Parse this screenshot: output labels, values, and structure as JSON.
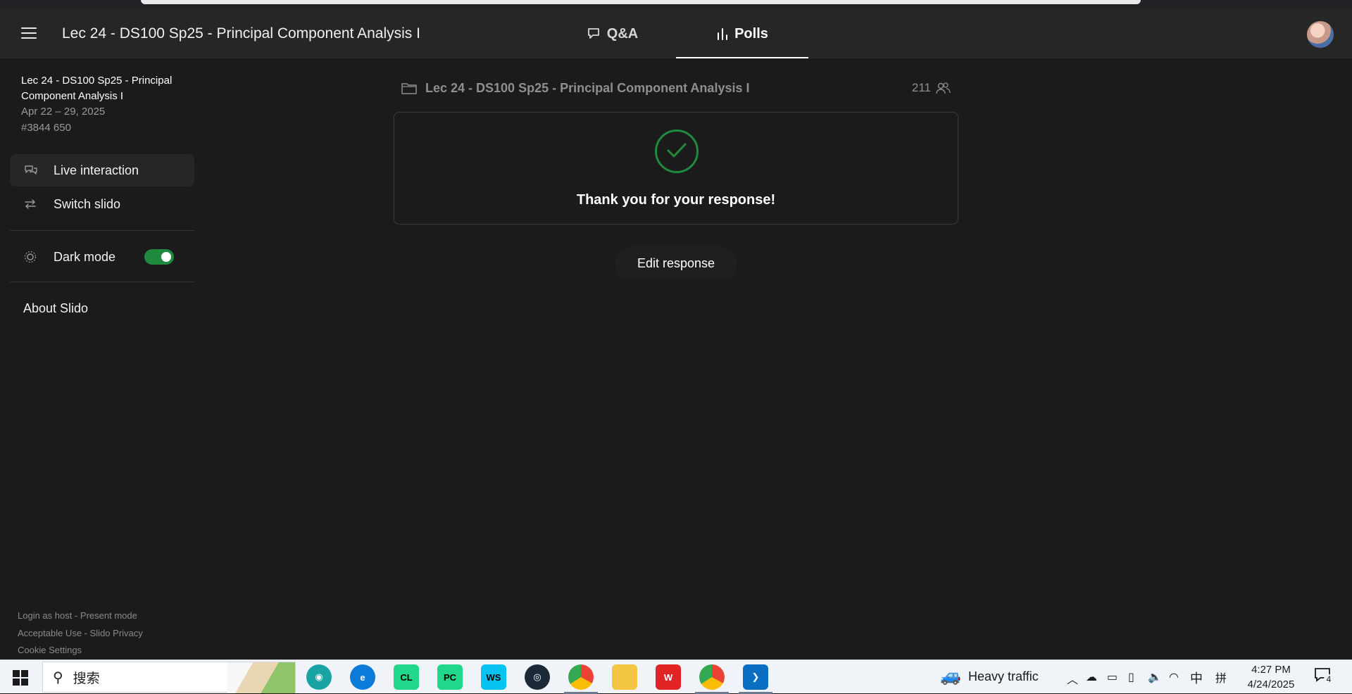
{
  "header": {
    "event_title": "Lec 24 - DS100 Sp25 - Principal Component Analysis I",
    "tabs": [
      {
        "label": "Q&A"
      },
      {
        "label": "Polls"
      }
    ]
  },
  "sidebar": {
    "title": "Lec 24 - DS100 Sp25 - Principal Component Analysis I",
    "dates": "Apr 22 – 29, 2025",
    "code": "#3844 650",
    "items": [
      {
        "label": "Live interaction",
        "icon": "chat-bubbles-icon"
      },
      {
        "label": "Switch slido",
        "icon": "swap-arrows-icon"
      }
    ],
    "dark_mode": {
      "label": "Dark mode",
      "enabled": true
    },
    "about": "About Slido",
    "footer": {
      "login_host": "Login as host",
      "sep1": " - ",
      "present_mode": "Present mode",
      "acceptable_use": "Acceptable Use",
      "sep2": " - ",
      "privacy": "Slido Privacy",
      "cookies": "Cookie Settings"
    }
  },
  "main": {
    "poll_title": "Lec 24 - DS100 Sp25 - Principal Component Analysis I",
    "participants": "211",
    "thanks": "Thank you for your response!",
    "edit_label": "Edit response"
  },
  "taskbar": {
    "search_placeholder": "搜索",
    "weather": "Heavy traffic",
    "ime": "中",
    "ime2": "拼",
    "time": "4:27 PM",
    "date": "4/24/2025",
    "notif_count": "4"
  },
  "colors": {
    "accent_green": "#1f8a3e",
    "background": "#1b1b1b",
    "topbar": "#262626"
  }
}
